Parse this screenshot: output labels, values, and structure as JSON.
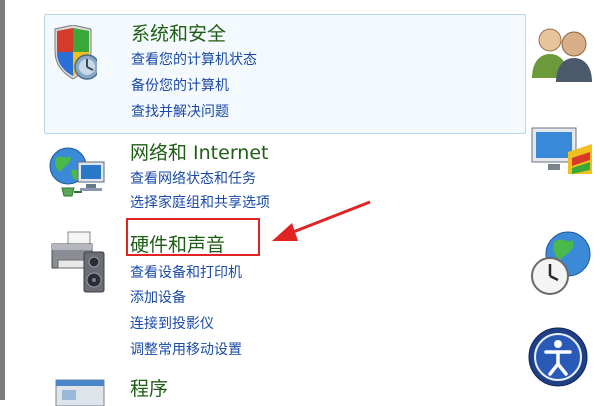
{
  "categories": [
    {
      "title": "系统和安全",
      "icon": "shield-icon",
      "links": [
        "查看您的计算机状态",
        "备份您的计算机",
        "查找并解决问题"
      ]
    },
    {
      "title": "网络和 Internet",
      "icon": "network-globe-icon",
      "links": [
        "查看网络状态和任务",
        "选择家庭组和共享选项"
      ]
    },
    {
      "title": "硬件和声音",
      "icon": "printer-speaker-icon",
      "links": [
        "查看设备和打印机",
        "添加设备",
        "连接到投影仪",
        "调整常用移动设置"
      ]
    },
    {
      "title": "程序",
      "icon": "programs-icon",
      "links": []
    }
  ],
  "right_icons": [
    "user-accounts-icon",
    "appearance-icon",
    "clock-globe-icon",
    "ease-of-access-icon"
  ],
  "colors": {
    "title_green": "#1e5e14",
    "link_blue": "#1a4aa6",
    "annotation_red": "#e02424"
  }
}
